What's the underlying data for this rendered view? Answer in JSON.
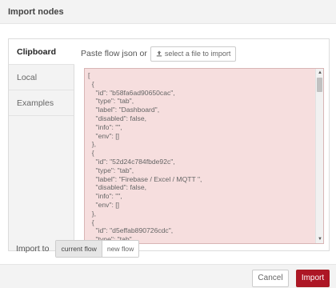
{
  "dialog": {
    "title": "Import nodes"
  },
  "tabs": [
    {
      "label": "Clipboard",
      "active": true
    },
    {
      "label": "Local",
      "active": false
    },
    {
      "label": "Examples",
      "active": false
    }
  ],
  "clipboard": {
    "paste_label": "Paste flow json or",
    "file_button_label": "select a file to import",
    "json_lines": [
      "[",
      "  {",
      "    \"id\": \"b58fa6ad90650cac\",",
      "    \"type\": \"tab\",",
      "    \"label\": \"Dashboard\",",
      "    \"disabled\": false,",
      "    \"info\": \"\",",
      "    \"env\": []",
      "  },",
      "  {",
      "    \"id\": \"52d24c784fbde92c\",",
      "    \"type\": \"tab\",",
      "    \"label\": \"Firebase / Excel / MQTT \",",
      "    \"disabled\": false,",
      "    \"info\": \"\",",
      "    \"env\": []",
      "  },",
      "  {",
      "    \"id\": \"d5effab890726cdc\",",
      "    \"type\": \"tab\","
    ]
  },
  "import_to": {
    "label": "Import to",
    "options": [
      {
        "label": "current flow",
        "selected": true
      },
      {
        "label": "new flow",
        "selected": false
      }
    ]
  },
  "footer": {
    "cancel_label": "Cancel",
    "import_label": "Import"
  },
  "colors": {
    "import_button": "#ad1625",
    "json_background": "#f6dede"
  }
}
